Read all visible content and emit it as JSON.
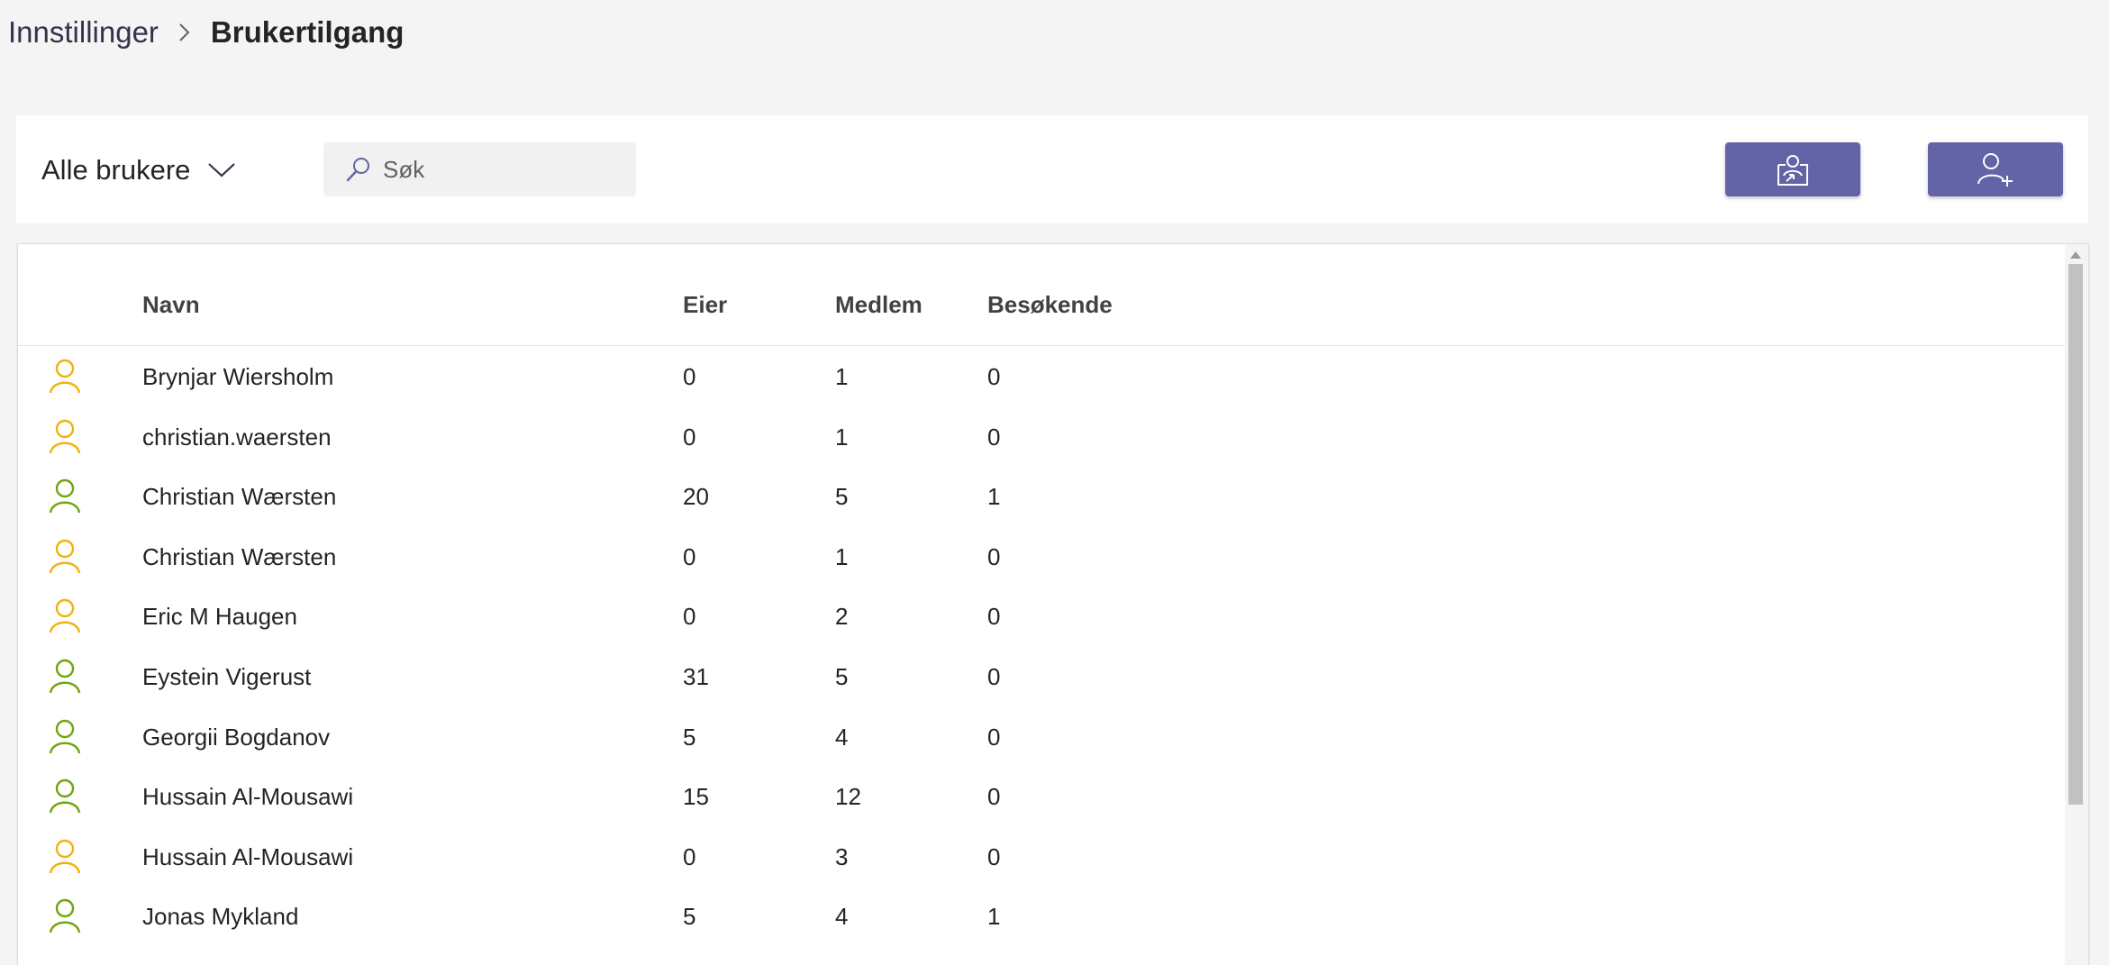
{
  "breadcrumb": {
    "parent": "Innstillinger",
    "current": "Brukertilgang"
  },
  "toolbar": {
    "filter_label": "Alle brukere",
    "search_placeholder": "Søk",
    "share_button_icon": "share-screen-icon",
    "add_user_button_icon": "add-user-icon"
  },
  "table": {
    "columns": [
      "Navn",
      "Eier",
      "Medlem",
      "Besøkende"
    ],
    "rows": [
      {
        "status": "guest",
        "name": "Brynjar Wiersholm",
        "owner": "0",
        "member": "1",
        "visitor": "0"
      },
      {
        "status": "guest",
        "name": "christian.waersten",
        "owner": "0",
        "member": "1",
        "visitor": "0"
      },
      {
        "status": "internal",
        "name": "Christian Wærsten",
        "owner": "20",
        "member": "5",
        "visitor": "1"
      },
      {
        "status": "guest",
        "name": "Christian Wærsten",
        "owner": "0",
        "member": "1",
        "visitor": "0"
      },
      {
        "status": "guest",
        "name": "Eric M Haugen",
        "owner": "0",
        "member": "2",
        "visitor": "0"
      },
      {
        "status": "internal",
        "name": "Eystein Vigerust",
        "owner": "31",
        "member": "5",
        "visitor": "0"
      },
      {
        "status": "internal",
        "name": "Georgii Bogdanov",
        "owner": "5",
        "member": "4",
        "visitor": "0"
      },
      {
        "status": "internal",
        "name": "Hussain Al-Mousawi",
        "owner": "15",
        "member": "12",
        "visitor": "0"
      },
      {
        "status": "guest",
        "name": "Hussain Al-Mousawi",
        "owner": "0",
        "member": "3",
        "visitor": "0"
      },
      {
        "status": "internal",
        "name": "Jonas Mykland",
        "owner": "5",
        "member": "4",
        "visitor": "1"
      }
    ]
  },
  "colors": {
    "accent": "#6264a7",
    "guest_user": "#f2b10e",
    "internal_user": "#6fa60f",
    "background": "#f4f4f4"
  },
  "icons": {
    "breadcrumb_separator": "chevron-right-icon",
    "filter": "chevron-down-icon",
    "search": "search-icon",
    "row_user": "person-icon"
  }
}
